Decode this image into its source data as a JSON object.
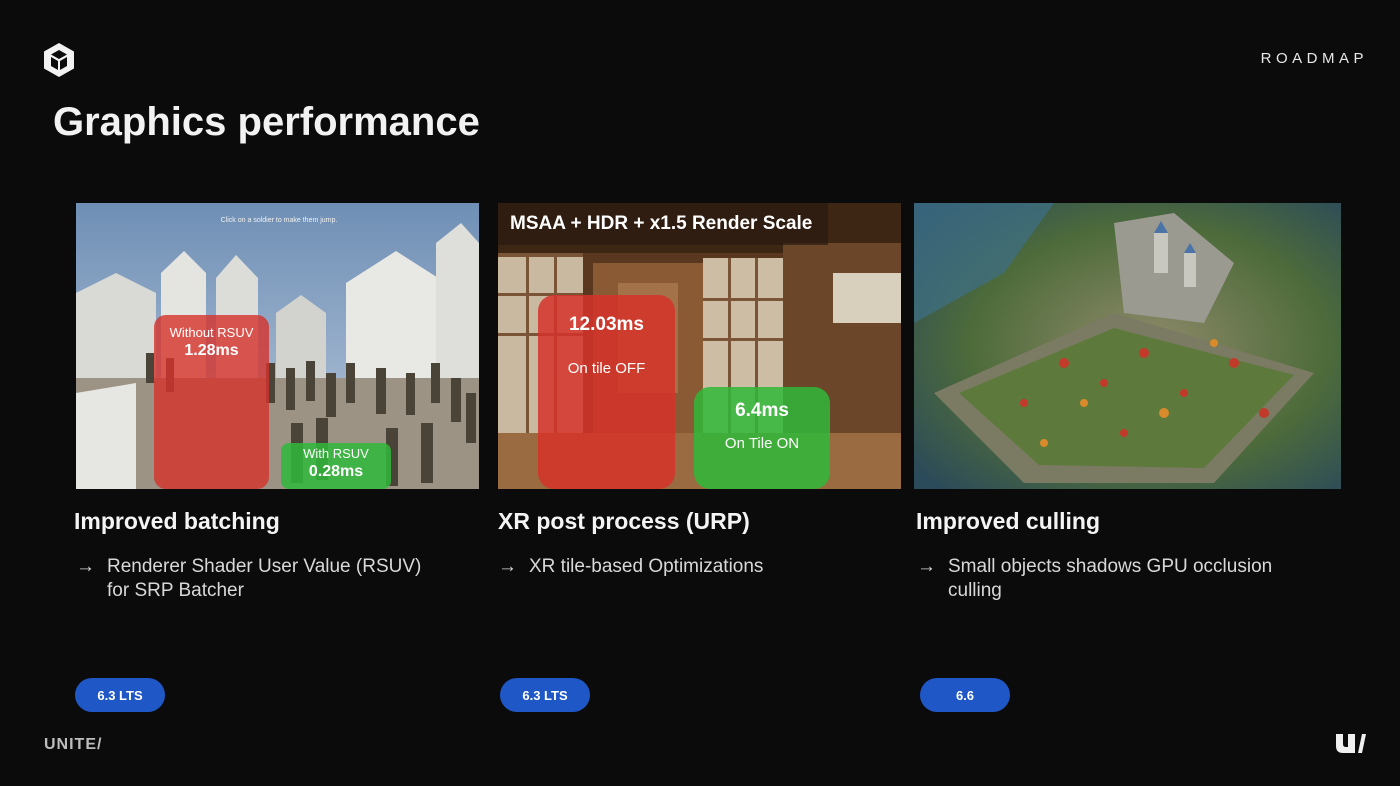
{
  "header": {
    "section_label": "ROADMAP",
    "title": "Graphics performance"
  },
  "cards": [
    {
      "title": "Improved batching",
      "bullet_arrow": "→",
      "bullet_lines": [
        "Renderer Shader User Value (RSUV)",
        "for SRP Batcher"
      ],
      "badge": "6.3 LTS",
      "image": {
        "caption": "Click on a soldier to make them jump.",
        "bar_red_label": "Without RSUV",
        "bar_red_value": "1.28ms",
        "bar_green_label": "With RSUV",
        "bar_green_value": "0.28ms"
      }
    },
    {
      "title": "XR post process (URP)",
      "bullet_arrow": "→",
      "bullet_lines": [
        "XR tile-based Optimizations"
      ],
      "badge": "6.3 LTS",
      "image": {
        "heading": "MSAA + HDR + x1.5 Render Scale",
        "bar_red_value": "12.03ms",
        "bar_red_label": "On tile OFF",
        "bar_green_value": "6.4ms",
        "bar_green_label": "On Tile ON"
      }
    },
    {
      "title": "Improved culling",
      "bullet_arrow": "→",
      "bullet_lines": [
        "Small objects shadows GPU occlusion",
        "culling"
      ],
      "badge": "6.6"
    }
  ],
  "footer": {
    "brand_text": "UNITE/"
  },
  "colors": {
    "background": "#0b0b0c",
    "badge_blue": "#2057c7",
    "bar_red": "#d6322a",
    "bar_green": "#2fb83a"
  }
}
